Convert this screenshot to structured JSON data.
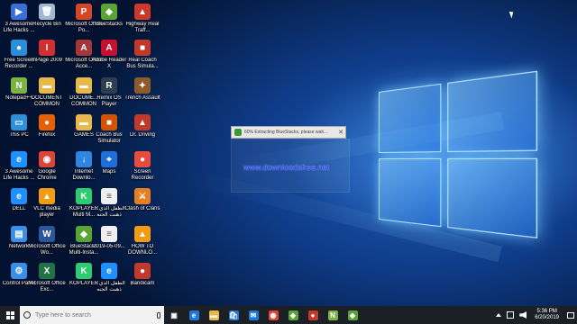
{
  "desktop": {
    "icons": [
      {
        "label": "3 Awesome Life Hacks ...",
        "icon": "video-file-icon",
        "color": "#3a6fd8",
        "glyph": "▶"
      },
      {
        "label": "Recycle Bin",
        "icon": "recycle-bin-icon",
        "color": "#9fb7cf",
        "glyph": "🗑"
      },
      {
        "label": "Microsoft Office Po...",
        "icon": "powerpoint-icon",
        "color": "#d24726",
        "glyph": "P"
      },
      {
        "label": "BlueStacks",
        "icon": "bluestacks-icon",
        "color": "#5aa335",
        "glyph": "◆"
      },
      {
        "label": "Highway Real Traff...",
        "icon": "game-icon",
        "color": "#c93a2a",
        "glyph": "▲"
      },
      {
        "label": "Free Screen Recorder ...",
        "icon": "screen-recorder-icon",
        "color": "#2a8fd8",
        "glyph": "●"
      },
      {
        "label": "InPage 2009",
        "icon": "inpage-icon",
        "color": "#d03030",
        "glyph": "I"
      },
      {
        "label": "Microsoft Office Acce...",
        "icon": "access-icon",
        "color": "#a4373a",
        "glyph": "A"
      },
      {
        "label": "Adobe Reader X",
        "icon": "adobe-reader-icon",
        "color": "#c8102e",
        "glyph": "A"
      },
      {
        "label": "Real Coach Bus Simula...",
        "icon": "bus-game-icon",
        "color": "#c0392b",
        "glyph": "■"
      },
      {
        "label": "Notepad++",
        "icon": "notepad-plus-plus-icon",
        "color": "#7cb342",
        "glyph": "N"
      },
      {
        "label": "DOCUMENT COMMON",
        "icon": "folder-icon",
        "color": "#e8b84a",
        "glyph": "▬"
      },
      {
        "label": "DOCUME... COMMON",
        "icon": "folder-icon",
        "color": "#e8b84a",
        "glyph": "▬"
      },
      {
        "label": "Remix OS Player",
        "icon": "remix-os-icon",
        "color": "#2c3e50",
        "glyph": "R"
      },
      {
        "label": "Trench Assault",
        "icon": "game-icon",
        "color": "#8e5a2a",
        "glyph": "✦"
      },
      {
        "label": "This PC",
        "icon": "this-pc-icon",
        "color": "#2f8fd8",
        "glyph": "▭"
      },
      {
        "label": "Firefox",
        "icon": "firefox-icon",
        "color": "#e66000",
        "glyph": "●"
      },
      {
        "label": "GAMES",
        "icon": "folder-icon",
        "color": "#e8b84a",
        "glyph": "▬"
      },
      {
        "label": "Coach Bus Simulator",
        "icon": "bus-game-icon",
        "color": "#d35400",
        "glyph": "■"
      },
      {
        "label": "Dr. Driving",
        "icon": "car-game-icon",
        "color": "#c0392b",
        "glyph": "▲"
      },
      {
        "label": "3 Awesome Life Hacks ...",
        "icon": "ie-file-icon",
        "color": "#1e90ff",
        "glyph": "e"
      },
      {
        "label": "Google Chrome",
        "icon": "chrome-icon",
        "color": "#db4437",
        "glyph": "◉"
      },
      {
        "label": "Internet Downlo...",
        "icon": "idm-icon",
        "color": "#2e86de",
        "glyph": "↓"
      },
      {
        "label": "Maps",
        "icon": "maps-icon",
        "color": "#1e6fd8",
        "glyph": "⌖"
      },
      {
        "label": "Screen Recorder",
        "icon": "screen-recorder-icon",
        "color": "#e74c3c",
        "glyph": "●"
      },
      {
        "label": "DELL",
        "icon": "ie-file-icon",
        "color": "#1e90ff",
        "glyph": "e"
      },
      {
        "label": "VLC media player",
        "icon": "vlc-icon",
        "color": "#f39c12",
        "glyph": "▲"
      },
      {
        "label": "KOPLAYER Multi M...",
        "icon": "koplayer-icon",
        "color": "#2ecc71",
        "glyph": "K"
      },
      {
        "label": "الطفل الذي ... ذهبت الجنه",
        "icon": "document-icon",
        "color": "#f0f0f0",
        "glyph": "≡"
      },
      {
        "label": "Clash of Clans",
        "icon": "game-icon",
        "color": "#e67e22",
        "glyph": "⚔"
      },
      {
        "label": "Network",
        "icon": "network-icon",
        "color": "#3a8ee6",
        "glyph": "▤"
      },
      {
        "label": "Microsoft Office Wo...",
        "icon": "word-icon",
        "color": "#2b579a",
        "glyph": "W"
      },
      {
        "label": "BlueStacks Multi-Insta...",
        "icon": "bluestacks-icon",
        "color": "#5aa335",
        "glyph": "◆"
      },
      {
        "label": "2019-05-09...",
        "icon": "document-icon",
        "color": "#f0f0f0",
        "glyph": "≡"
      },
      {
        "label": "HOW TO DOWNLO...",
        "icon": "vlc-file-icon",
        "color": "#f39c12",
        "glyph": "▲"
      },
      {
        "label": "Control Panel",
        "icon": "control-panel-icon",
        "color": "#3a8ee6",
        "glyph": "⚙"
      },
      {
        "label": "Microsoft Office Exc...",
        "icon": "excel-icon",
        "color": "#217346",
        "glyph": "X"
      },
      {
        "label": "KOPLAYER",
        "icon": "koplayer-icon",
        "color": "#2ecc71",
        "glyph": "K"
      },
      {
        "label": "الطفل الذي ... ذهبت الجنه",
        "icon": "ie-file-icon",
        "color": "#1e90ff",
        "glyph": "e"
      },
      {
        "label": "Bandicam",
        "icon": "bandicam-icon",
        "color": "#c0392b",
        "glyph": "●"
      }
    ]
  },
  "progress_window": {
    "text": "60% Extracting BlueStacks, please wait...",
    "close": "✕"
  },
  "watermark": "www.downloadsfree.net",
  "taskbar": {
    "search_placeholder": "Type here to search",
    "apps": [
      {
        "name": "task-view",
        "glyph": "▣",
        "color": "#1b1f26"
      },
      {
        "name": "edge",
        "glyph": "e",
        "color": "#1e78d7"
      },
      {
        "name": "file-explorer",
        "glyph": "▬",
        "color": "#e8b84a"
      },
      {
        "name": "store",
        "glyph": "🛍",
        "color": "#1e78d7"
      },
      {
        "name": "mail",
        "glyph": "✉",
        "color": "#1e78d7"
      },
      {
        "name": "chrome",
        "glyph": "◉",
        "color": "#db4437"
      },
      {
        "name": "bluestacks",
        "glyph": "◆",
        "color": "#5aa335"
      },
      {
        "name": "bandicam",
        "glyph": "●",
        "color": "#c0392b"
      },
      {
        "name": "notepad-plus-plus",
        "glyph": "N",
        "color": "#7cb342"
      },
      {
        "name": "bluestacks-installer",
        "glyph": "◆",
        "color": "#5aa335"
      }
    ],
    "time": "5:36 PM",
    "date": "6/20/2019"
  }
}
